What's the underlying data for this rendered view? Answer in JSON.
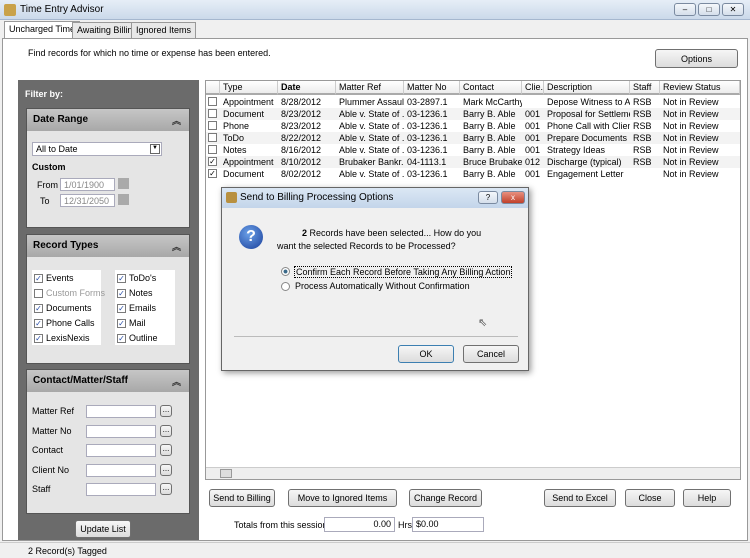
{
  "window": {
    "title": "Time Entry Advisor"
  },
  "tabs": [
    {
      "label": "Uncharged Time",
      "active": true
    },
    {
      "label": "Awaiting Billing"
    },
    {
      "label": "Ignored Items"
    }
  ],
  "instructions": "Find records for which no time or expense has been entered.",
  "options_label": "Options",
  "filter": {
    "title": "Filter by:",
    "date_range": {
      "title": "Date Range",
      "selected": "All to Date",
      "custom_label": "Custom",
      "from_label": "From",
      "from_value": "1/01/1900",
      "to_label": "To",
      "to_value": "12/31/2050"
    },
    "record_types": {
      "title": "Record Types",
      "left": [
        {
          "label": "Events",
          "checked": true
        },
        {
          "label": "Custom Forms",
          "checked": false,
          "disabled": true
        },
        {
          "label": "Documents",
          "checked": true
        },
        {
          "label": "Phone Calls",
          "checked": true
        },
        {
          "label": "LexisNexis",
          "checked": true
        }
      ],
      "right": [
        {
          "label": "ToDo's",
          "checked": true
        },
        {
          "label": "Notes",
          "checked": true
        },
        {
          "label": "Emails",
          "checked": true
        },
        {
          "label": "Mail",
          "checked": true
        },
        {
          "label": "Outline",
          "checked": true
        }
      ]
    },
    "contact": {
      "title": "Contact/Matter/Staff",
      "fields": [
        {
          "label": "Matter Ref"
        },
        {
          "label": "Matter No"
        },
        {
          "label": "Contact"
        },
        {
          "label": "Client No"
        },
        {
          "label": "Staff"
        }
      ],
      "browse_label": "..."
    },
    "update_label": "Update List"
  },
  "grid": {
    "columns": [
      "Type",
      "Date",
      "Matter Ref",
      "Matter No",
      "Contact",
      "Clie...",
      "Description",
      "Staff",
      "Review Status"
    ],
    "rows": [
      {
        "checked": false,
        "cells": [
          "Appointment",
          "8/28/2012",
          "Plummer Assault",
          "03-2897.1",
          "Mark McCarthy",
          "",
          "Depose Witness to A...",
          "RSB",
          "Not in Review"
        ]
      },
      {
        "checked": false,
        "cells": [
          "Document",
          "8/23/2012",
          "Able v. State of ...",
          "03-1236.1",
          "Barry B. Able",
          "001",
          "Proposal for Settlement",
          "RSB",
          "Not in Review"
        ]
      },
      {
        "checked": false,
        "cells": [
          "Phone",
          "8/23/2012",
          "Able v. State of ...",
          "03-1236.1",
          "Barry B. Able",
          "001",
          "Phone Call with Client",
          "RSB",
          "Not in Review"
        ]
      },
      {
        "checked": false,
        "cells": [
          "ToDo",
          "8/22/2012",
          "Able v. State of ...",
          "03-1236.1",
          "Barry B. Able",
          "001",
          "Prepare Documents",
          "RSB",
          "Not in Review"
        ]
      },
      {
        "checked": false,
        "cells": [
          "Notes",
          "8/16/2012",
          "Able v. State of ...",
          "03-1236.1",
          "Barry B. Able",
          "001",
          "Strategy Ideas",
          "RSB",
          "Not in Review"
        ]
      },
      {
        "checked": true,
        "cells": [
          "Appointment",
          "8/10/2012",
          "Brubaker Bankr...",
          "04-1113.1",
          "Bruce Brubaker",
          "012",
          "Discharge (typical)",
          "RSB",
          "Not in Review"
        ]
      },
      {
        "checked": true,
        "cells": [
          "Document",
          "8/02/2012",
          "Able v. State of ...",
          "03-1236.1",
          "Barry B. Able",
          "001",
          "Engagement Letter",
          "",
          "Not in Review"
        ]
      }
    ]
  },
  "buttons": {
    "send_billing": "Send to Billing",
    "move_ignored": "Move to Ignored Items",
    "change_record": "Change Record",
    "send_excel": "Send to Excel",
    "close": "Close",
    "help": "Help"
  },
  "totals": {
    "label": "Totals from this session :",
    "hours": "0.00",
    "hrs_label": "Hrs",
    "amount": "$0.00"
  },
  "status": "2 Record(s) Tagged",
  "dialog": {
    "title": "Send to Billing Processing Options",
    "count": "2",
    "message1": " Records have been selected... How do you",
    "message2": "want the selected Records to be Processed?",
    "option1": "Confirm Each Record Before Taking Any Billing Action",
    "option2": "Process Automatically Without Confirmation",
    "selected": 1,
    "ok": "OK",
    "cancel": "Cancel",
    "help": "?",
    "close": "x"
  }
}
